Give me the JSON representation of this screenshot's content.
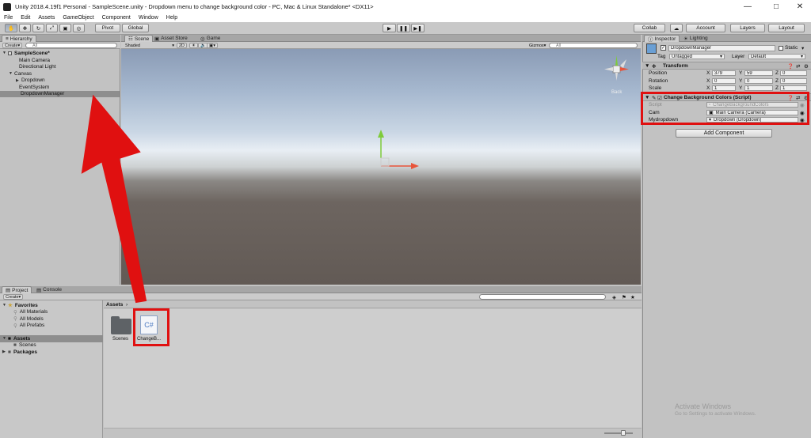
{
  "window": {
    "title": "Unity 2018.4.19f1 Personal - SampleScene.unity - Dropdown menu to change background color - PC, Mac & Linux Standalone* <DX11>"
  },
  "menu": [
    "File",
    "Edit",
    "Assets",
    "GameObject",
    "Component",
    "Window",
    "Help"
  ],
  "toolbar": {
    "pivot": "Pivot",
    "global": "Global",
    "collab": "Collab",
    "account": "Account",
    "layers": "Layers",
    "layout": "Layout"
  },
  "hierarchy": {
    "tab": "Hierarchy",
    "create": "Create",
    "search_placeholder": "All",
    "scene": "SampleScene*",
    "items": [
      "Main Camera",
      "Directional Light",
      "Canvas",
      "Dropdown",
      "EventSystem",
      "DropdownManager"
    ]
  },
  "scene": {
    "tabs": [
      "Scene",
      "Asset Store",
      "Game"
    ],
    "shaded": "Shaded",
    "mode_2d": "2D",
    "gizmos": "Gizmos",
    "search_placeholder": "All",
    "gizmo_label": "Back"
  },
  "inspector": {
    "tabs": [
      "Inspector",
      "Lighting"
    ],
    "object_name": "DropdownManager",
    "static": "Static",
    "tag_label": "Tag",
    "tag_value": "Untagged",
    "layer_label": "Layer",
    "layer_value": "Default",
    "transform": {
      "title": "Transform",
      "rows": [
        {
          "label": "Position",
          "x": "379",
          "y": "59",
          "z": "0"
        },
        {
          "label": "Rotation",
          "x": "0",
          "y": "0",
          "z": "0"
        },
        {
          "label": "Scale",
          "x": "1",
          "y": "1",
          "z": "1"
        }
      ]
    },
    "script_component": {
      "title": "Change Background Colors (Script)",
      "rows": [
        {
          "label": "Script",
          "value": "ChangeBackgroundColors"
        },
        {
          "label": "Cam",
          "value": "Main Camera (Camera)"
        },
        {
          "label": "Mydropdown",
          "value": "Dropdown (Dropdown)"
        }
      ]
    },
    "add_component": "Add Component"
  },
  "project": {
    "tabs": [
      "Project",
      "Console"
    ],
    "create": "Create",
    "favorites": {
      "title": "Favorites",
      "items": [
        "All Materials",
        "All Models",
        "All Prefabs"
      ]
    },
    "assets_tree": {
      "title": "Assets",
      "items": [
        "Scenes"
      ]
    },
    "packages": "Packages",
    "breadcrumb": "Assets",
    "files": [
      {
        "name": "Scenes",
        "type": "folder"
      },
      {
        "name": "ChangeB...",
        "type": "script",
        "glyph": "C#"
      }
    ]
  },
  "watermark": {
    "line1": "Activate Windows",
    "line2": "Go to Settings to activate Windows."
  },
  "colors": {
    "annotation_red": "#e01010",
    "selection": "#8e8e8e"
  }
}
